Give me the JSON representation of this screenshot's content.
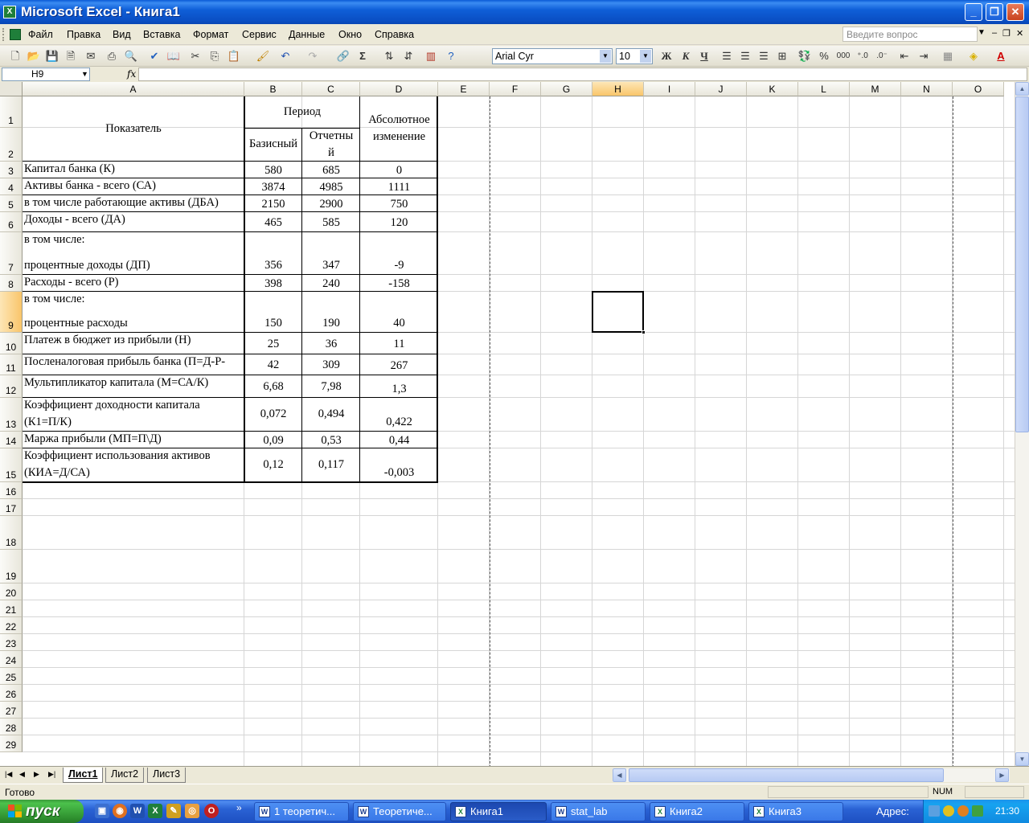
{
  "window": {
    "title": "Microsoft Excel - Книга1",
    "app_icon": "excel-icon",
    "minimize_icon": "minimize-icon",
    "maximize_icon": "restore-icon",
    "close_icon": "close-icon"
  },
  "menu": {
    "items": [
      "Файл",
      "Правка",
      "Вид",
      "Вставка",
      "Формат",
      "Сервис",
      "Данные",
      "Окно",
      "Справка"
    ],
    "help_placeholder": "Введите вопрос"
  },
  "toolbar": {
    "font_name": "Arial Cyr",
    "font_size": "10",
    "bold_label": "Ж",
    "italic_label": "К",
    "underline_label": "Ч",
    "percent_label": "%",
    "thousands_label": "000",
    "sum_label": "Σ"
  },
  "formula_bar": {
    "name_box": "H9",
    "fx_label": "fx",
    "formula": ""
  },
  "grid": {
    "columns": [
      "A",
      "B",
      "C",
      "D",
      "E",
      "F",
      "G",
      "H",
      "I",
      "J",
      "K",
      "L",
      "M",
      "N",
      "O"
    ],
    "selected_column": "H",
    "selected_row": "9",
    "rows": [
      "1",
      "2",
      "3",
      "4",
      "5",
      "6",
      "7",
      "8",
      "9",
      "10",
      "11",
      "12",
      "13",
      "14",
      "15",
      "16",
      "17",
      "18",
      "19",
      "20",
      "21",
      "22",
      "23",
      "24",
      "25",
      "26",
      "27",
      "28",
      "29"
    ]
  },
  "table": {
    "header_indicator": "Показатель",
    "header_period": "Период",
    "header_base": "Базисный",
    "header_report_1": "Отчетны",
    "header_report_2": "й",
    "header_change_1": "Абсолютное",
    "header_change_2": "изменение",
    "rows": [
      {
        "label": "Капитал банка (К)",
        "label2": "",
        "b": "580",
        "c": "685",
        "d": "0"
      },
      {
        "label": "Активы банка - всего (СА)",
        "label2": "",
        "b": "3874",
        "c": "4985",
        "d": "1111"
      },
      {
        "label": "в том числе работающие активы (ДБА)",
        "label2": "",
        "b": "2150",
        "c": "2900",
        "d": "750"
      },
      {
        "label": "Доходы - всего (ДА)",
        "label2": "",
        "b": "465",
        "c": "585",
        "d": "120"
      },
      {
        "label": "в том числе:",
        "label2": "процентные доходы (ДП)",
        "b": "356",
        "c": "347",
        "d": "-9"
      },
      {
        "label": "Расходы - всего (Р)",
        "label2": "",
        "b": "398",
        "c": "240",
        "d": "-158"
      },
      {
        "label": "в том числе:",
        "label2": "процентные расходы",
        "b": "150",
        "c": "190",
        "d": "40"
      },
      {
        "label": "Платеж в бюджет из прибыли (Н)",
        "label2": "",
        "b": "25",
        "c": "36",
        "d": "11"
      },
      {
        "label": "Посленалоговая прибыль банка (П=Д-Р-",
        "label2": "",
        "b": "42",
        "c": "309",
        "d": "267"
      },
      {
        "label": "Мультипликатор капитала (М=СА/К)",
        "label2": "",
        "b": "6,68",
        "c": "7,98",
        "d": "1,3"
      },
      {
        "label": "Коэффициент доходности капитала",
        "label2": "(К1=П/К)",
        "b": "0,072",
        "c": "0,494",
        "d": "0,422"
      },
      {
        "label": "Маржа прибыли (МП=П\\Д)",
        "label2": "",
        "b": "0,09",
        "c": "0,53",
        "d": "0,44"
      },
      {
        "label": "Коэффициент использования активов",
        "label2": "(КИА=Д/СА)",
        "b": "0,12",
        "c": "0,117",
        "d": "-0,003"
      }
    ]
  },
  "sheets": {
    "tabs": [
      "Лист1",
      "Лист2",
      "Лист3"
    ],
    "active": "Лист1"
  },
  "status": {
    "text": "Готово",
    "num": "NUM"
  },
  "taskbar": {
    "start_label": "пуск",
    "more": "»",
    "tasks": [
      "1 теоретич...",
      "Теоретиче...",
      "Книга1",
      "stat_lab",
      "Книга2",
      "Книга3"
    ],
    "active_task": "Книга1",
    "address_label": "Адрес:",
    "clock": "21:30"
  }
}
